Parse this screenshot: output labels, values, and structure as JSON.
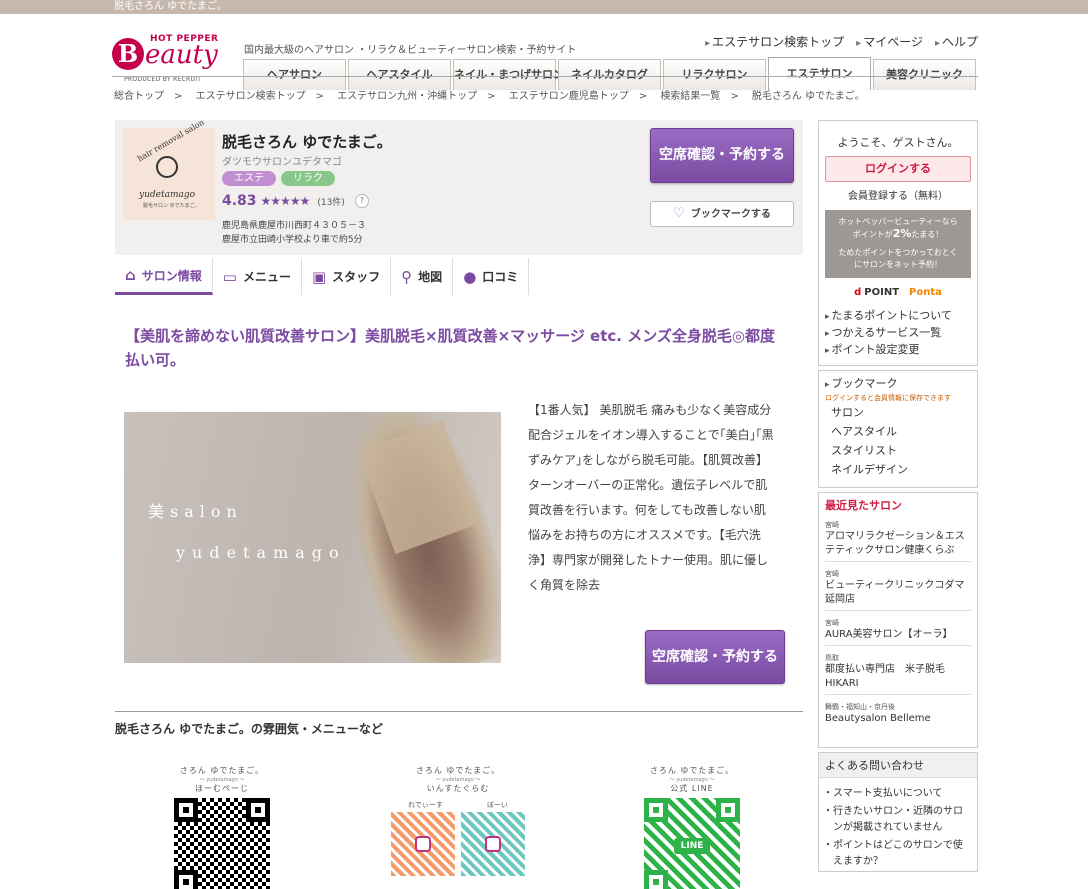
{
  "topbar": {
    "text": "脱毛さろん ゆでたまご。"
  },
  "header": {
    "logo": {
      "hot_pepper": "HOT PEPPER",
      "b": "B",
      "eauty": "eauty",
      "produced": "PRODUCED BY RECRUIT"
    },
    "tagline": "国内最大級のヘアサロン ・リラク＆ビューティーサロン検索・予約サイト",
    "links": [
      "エステサロン検索トップ",
      "マイページ",
      "ヘルプ"
    ],
    "tabs": [
      "ヘアサロン",
      "ヘアスタイル",
      "ネイル・まつげサロン",
      "ネイルカタログ",
      "リラクサロン",
      "エステサロン",
      "美容クリニック"
    ]
  },
  "breadcrumb": [
    "総合トップ",
    "エステサロン検索トップ",
    "エステサロン九州・沖縄トップ",
    "エステサロン鹿児島トップ",
    "検索結果一覧",
    "脱毛さろん ゆでたまご。"
  ],
  "salon": {
    "logo_text": {
      "t1": "hair removal salon",
      "t2": "yudetamago",
      "t3": "脱毛サロン ゆでたまご。"
    },
    "name": "脱毛さろん ゆでたまご。",
    "kana": "ダツモウサロンユデタマゴ",
    "chips": [
      "エステ",
      "リラク"
    ],
    "rating": {
      "score": "4.83",
      "stars": "★★★★★",
      "count": "(13件)",
      "help": "?"
    },
    "address": "鹿児島県鹿屋市川西町４３０５－３",
    "access": "鹿屋市立田崎小学校より車で約5分",
    "reserve_label": "空席確認・予約する",
    "bookmark_label": "ブックマークする"
  },
  "subtabs": [
    {
      "label": "サロン情報",
      "icon": "home-icon"
    },
    {
      "label": "メニュー",
      "icon": "book-icon"
    },
    {
      "label": "スタッフ",
      "icon": "staff-card-icon"
    },
    {
      "label": "地図",
      "icon": "map-pin-icon"
    },
    {
      "label": "口コミ",
      "icon": "chat-bubble-icon"
    }
  ],
  "catch_copy": "【美肌を諦めない肌質改善サロン】美肌脱毛×肌質改善×マッサージ etc. メンズ全身脱毛◎都度払い可。",
  "photo_text": {
    "line1": "美salon",
    "line2": "yudetamago"
  },
  "description": "【1番人気】 美肌脱毛 痛みも少なく美容成分配合ジェルをイオン導入することで｢美白｣｢黒ずみケア｣をしながら脱毛可能。【肌質改善】ターンオーバーの正常化。遺伝子レベルで肌質改善を行います。何をしても改善しない肌悩みをお持ちの方にオススメです。【毛穴洗浄】専門家が開発したトナー使用。肌に優しく角質を除去",
  "reserve_mid_label": "空席確認・予約する",
  "atmosphere_title": "脱毛さろん ゆでたまご。の雰囲気・メニューなど",
  "qr_cards": [
    {
      "cap1": "さろん ゆでたまご。",
      "cap2": "～ yudetamago ～",
      "cap3": "ほーむぺーじ"
    },
    {
      "cap1": "さろん ゆでたまご。",
      "cap2": "～ yudetamago ～",
      "cap3": "いんすたぐらむ",
      "sub": [
        "れでぃーす",
        "ぼーい"
      ]
    },
    {
      "cap1": "さろん ゆでたまご。",
      "cap2": "～ yudetamago ～",
      "cap3": "公式 LINE",
      "badge": "LINE"
    }
  ],
  "sidebar": {
    "welcome": "ようこそ、ゲストさん。",
    "login": "ログインする",
    "register": "会員登録する（無料）",
    "promo_line1": "ホットペッパービューティーなら",
    "promo_line2a": "ポイントが",
    "promo_line2b": "2%",
    "promo_line2c": "たまる！",
    "promo_line3": "ためたポイントをつかっておとく",
    "promo_line4": "にサロンをネット予約！",
    "dpoint": "POINT",
    "ponta": "Ponta",
    "links": [
      "たまるポイントについて",
      "つかえるサービス一覧",
      "ポイント設定変更"
    ],
    "bookmark": {
      "title": "ブックマーク",
      "note": "ログインすると会員情報に保存できます",
      "items": [
        "サロン",
        "ヘアスタイル",
        "スタイリスト",
        "ネイルデザイン"
      ]
    },
    "recent": {
      "title": "最近見たサロン",
      "items": [
        {
          "pref": "宮崎",
          "name": "アロマリラクゼーション＆エステティックサロン健康くらぶ"
        },
        {
          "pref": "宮崎",
          "name": "ビューティークリニックコダマ延岡店"
        },
        {
          "pref": "宮崎",
          "name": "AURA美容サロン【オーラ】"
        },
        {
          "pref": "鳥取",
          "name": "都度払い専門店　米子脱毛HIKARI"
        },
        {
          "pref": "舞鶴・福知山・京丹後",
          "name": "Beautysalon Belleme"
        }
      ]
    },
    "faq": {
      "title": "よくある問い合わせ",
      "items": [
        "スマート支払いについて",
        "行きたいサロン・近隣のサロンが掲載されていません",
        "ポイントはどこのサロンで使えますか？"
      ]
    }
  }
}
